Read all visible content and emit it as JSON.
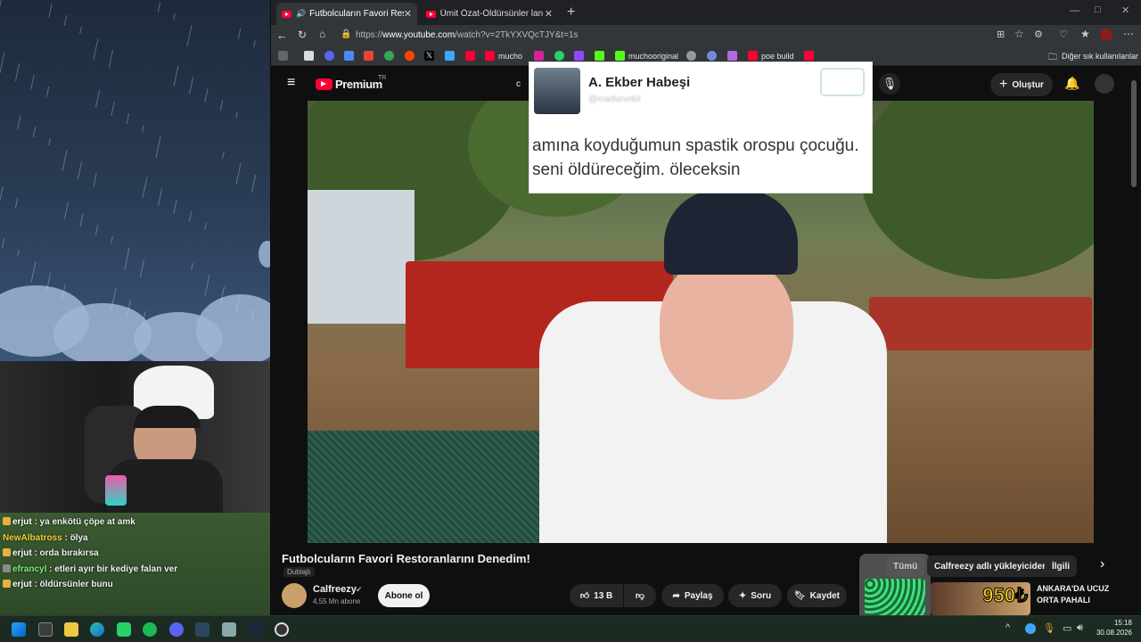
{
  "stream": {
    "chat": [
      {
        "user": "erjut",
        "message": " : ya enkötü çöpe at amk",
        "color": "white",
        "badge": true
      },
      {
        "user": "NewAlbatross",
        "message": " : ölya",
        "color": "yellow",
        "badge": false
      },
      {
        "user": "erjut",
        "message": " : orda bırakırsa",
        "color": "white",
        "badge": true
      },
      {
        "user": "efrancyl",
        "message": " : etleri ayır bir kediye falan ver",
        "color": "green",
        "badge": true
      },
      {
        "user": "erjut",
        "message": " : öldürsünler bunu",
        "color": "white",
        "badge": true
      }
    ]
  },
  "browser": {
    "tabs": [
      {
        "label": "Futbolcuların Favori Restoranl",
        "active": true
      },
      {
        "label": "Ümit Özat-Öldürsünler lan onu fut",
        "active": false
      }
    ],
    "url_prefix": "https://",
    "url_domain": "www.youtube.com",
    "url_rest": "/watch?v=2TkYXVQcTJY&t=1s",
    "bookmarks": {
      "mucho": "mucho",
      "muchooriginal": "muchooriginal",
      "poe_build": "poe build",
      "other": "Diğer sık kullanılanlar"
    }
  },
  "youtube": {
    "brand": "Premium",
    "brand_sup": "TR",
    "search_partial": "c",
    "create_label": "Oluştur",
    "overlay": {
      "name": "A. Ekber Habeşi",
      "handle": "@madurvekil",
      "tweet": "amına koyduğumun spastik orospu çocuğu. seni öldüreceğim. öleceksin"
    },
    "video": {
      "title": "Futbolcuların Favori Restoranlarını Denedim!",
      "dub_label": "Dublajlı",
      "channel": "Calfreezy",
      "subscribers": "4,55 Mn abone",
      "subscribe_label": "Abone ol",
      "likes": "13 B",
      "share_label": "Paylaş",
      "ask_label": "Soru",
      "save_label": "Kaydet"
    },
    "chips": {
      "all": "Tümü",
      "uploader": "Calfreezy adlı yükleyiciden",
      "related": "İlgili"
    },
    "recommendation": {
      "price": "950₺",
      "title_line1": "ANKARA'DA UCUZ",
      "title_line2": "ORTA PAHALI"
    }
  },
  "taskbar": {
    "time": "15:18",
    "date": "30.08.2026"
  }
}
